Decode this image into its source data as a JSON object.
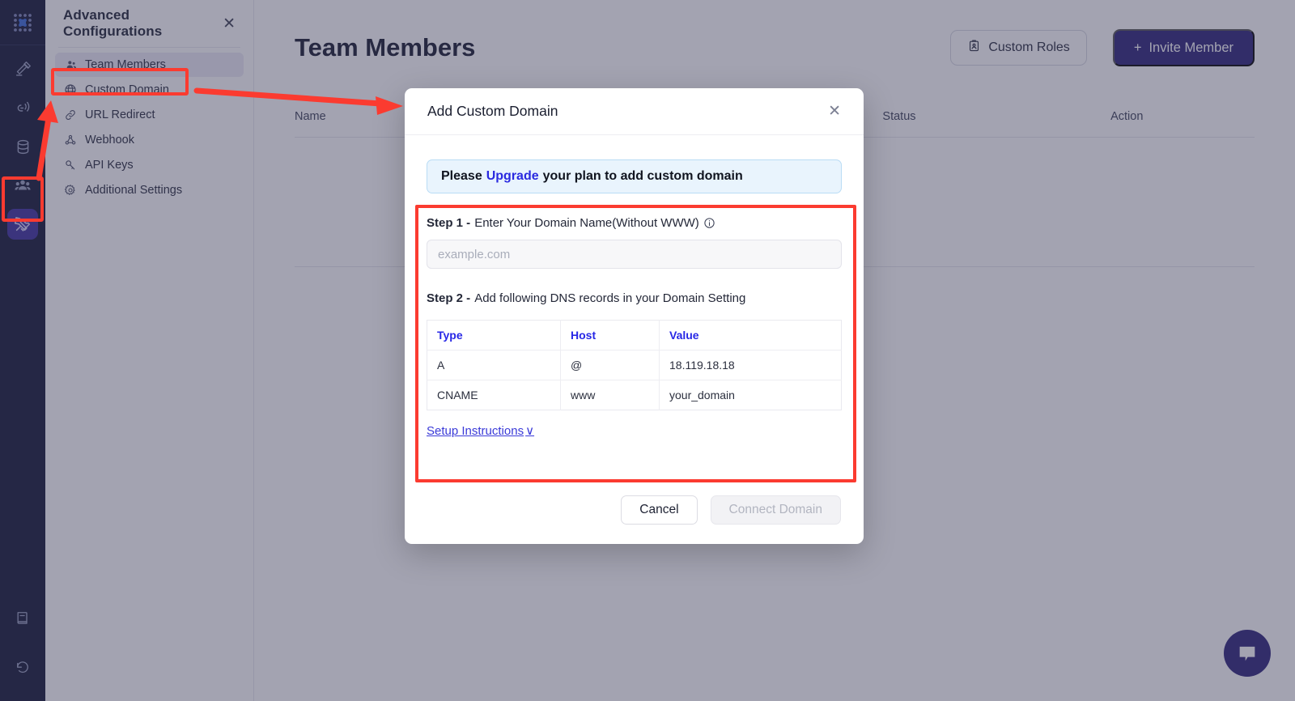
{
  "rail": {
    "logo_name": "app-logo",
    "items": [
      {
        "name": "gavel-icon",
        "label": "Auctions"
      },
      {
        "name": "broadcast-icon",
        "label": "Broadcast"
      },
      {
        "name": "database-icon",
        "label": "Database"
      },
      {
        "name": "people-icon",
        "label": "Audience"
      },
      {
        "name": "tools-icon",
        "label": "Advanced Configurations",
        "active": true
      }
    ],
    "bottom_items": [
      {
        "name": "book-icon",
        "label": "Docs"
      },
      {
        "name": "history-icon",
        "label": "History"
      }
    ]
  },
  "config_panel": {
    "title": "Advanced Configurations",
    "close_label": "✕",
    "items": [
      {
        "label": "Team Members",
        "icon": "people-icon",
        "selected": true
      },
      {
        "label": "Custom Domain",
        "icon": "globe-icon",
        "selected": false
      },
      {
        "label": "URL Redirect",
        "icon": "link-icon",
        "selected": false
      },
      {
        "label": "Webhook",
        "icon": "webhook-icon",
        "selected": false
      },
      {
        "label": "API Keys",
        "icon": "key-icon",
        "selected": false
      },
      {
        "label": "Additional Settings",
        "icon": "gear-icon",
        "selected": false
      }
    ]
  },
  "main": {
    "page_title": "Team Members",
    "custom_roles_label": "Custom Roles",
    "invite_member_label": "Invite Member",
    "invite_plus": "+",
    "table_headers": {
      "name": "Name",
      "email": "",
      "status": "Status",
      "action": "Action"
    }
  },
  "modal": {
    "title": "Add Custom Domain",
    "close_label": "✕",
    "notice": {
      "prefix": "Please",
      "link": "Upgrade",
      "suffix": "your plan to add custom domain"
    },
    "step1": {
      "label": "Step 1 -",
      "text": "Enter Your Domain Name(Without WWW)",
      "info_icon": "info-icon",
      "input_value": "",
      "input_placeholder": "example.com"
    },
    "step2": {
      "label": "Step 2 -",
      "text": "Add following DNS records in your Domain Setting"
    },
    "dns_table": {
      "headers": [
        "Type",
        "Host",
        "Value"
      ],
      "rows": [
        {
          "type": "A",
          "host": "@",
          "value": "18.119.18.18"
        },
        {
          "type": "CNAME",
          "host": "www",
          "value": "your_domain"
        }
      ]
    },
    "setup_link": "Setup Instructions",
    "setup_chevron": "∨",
    "cancel_label": "Cancel",
    "connect_label": "Connect Domain"
  },
  "chat": {
    "icon": "chat-bubble-icon"
  },
  "colors": {
    "rail_bg": "#121634",
    "rail_active": "#3b2f9e",
    "primary": "#2b2178",
    "link_blue": "#2727e6",
    "notice_bg": "#e9f4fd",
    "notice_border": "#b9dcf5",
    "annotation_red": "#fb3b30",
    "overlay": "rgba(60,60,90,0.47)"
  }
}
